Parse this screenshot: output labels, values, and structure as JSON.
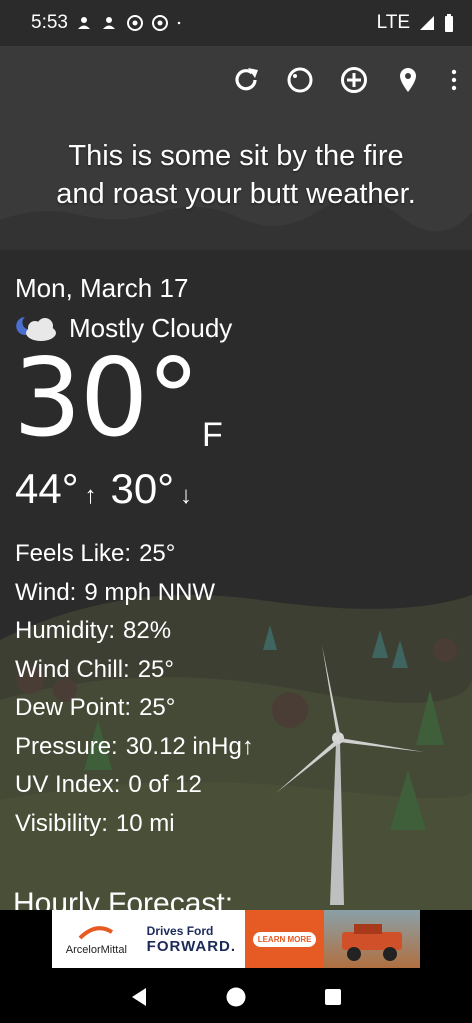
{
  "status_bar": {
    "time": "5:53",
    "network": "LTE",
    "icons": [
      "account-icon",
      "account-icon",
      "chrome-icon",
      "chrome-icon",
      "dot-icon",
      "signal-icon",
      "battery-icon"
    ]
  },
  "toolbar": {
    "icons": [
      "refresh-icon",
      "theme-icon",
      "add-location-icon",
      "location-pin-icon",
      "more-vert-icon"
    ]
  },
  "headline": {
    "line1": "This is some sit by the fire",
    "line2": "and roast your butt weather."
  },
  "current": {
    "date": "Mon, March 17",
    "condition": "Mostly Cloudy",
    "condition_icon": "partly-cloudy-night-icon",
    "temperature": "30°",
    "unit": "F",
    "high": "44°",
    "low": "30°",
    "high_arrow": "↑",
    "low_arrow": "↓"
  },
  "details": [
    {
      "label": "Feels Like:",
      "value": "25°"
    },
    {
      "label": "Wind:",
      "value": "9 mph NNW"
    },
    {
      "label": "Humidity:",
      "value": "82%"
    },
    {
      "label": "Wind Chill:",
      "value": "25°"
    },
    {
      "label": "Dew Point:",
      "value": "25°"
    },
    {
      "label": "Pressure:",
      "value": "30.12 inHg↑"
    },
    {
      "label": "UV Index:",
      "value": "0 of 12"
    },
    {
      "label": "Visibility:",
      "value": "10 mi"
    }
  ],
  "hourly": {
    "title": "Hourly Forecast:"
  },
  "ad": {
    "brand": "ArcelorMittal",
    "line1": "Drives Ford",
    "line2": "FORWARD.",
    "cta": "LEARN MORE",
    "accent_color": "#e65a23"
  },
  "nav_bar": {
    "icons": [
      "back-icon",
      "home-icon",
      "recents-icon"
    ]
  }
}
